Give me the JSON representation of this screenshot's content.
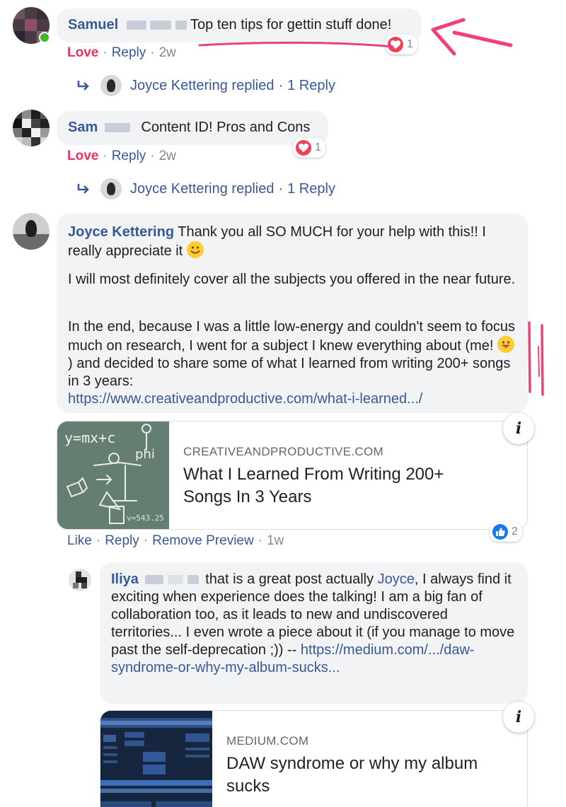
{
  "comments": [
    {
      "author": "Samuel",
      "text": "Top ten tips for gettin stuff done!",
      "actions": {
        "love": "Love",
        "reply": "Reply",
        "time": "2w"
      },
      "reaction_count": "1",
      "replied": {
        "name": "Joyce Kettering replied",
        "count": "1 Reply"
      }
    },
    {
      "author": "Sam",
      "text": "Content ID! Pros and Cons",
      "actions": {
        "love": "Love",
        "reply": "Reply",
        "time": "2w"
      },
      "reaction_count": "1",
      "replied": {
        "name": "Joyce Kettering replied",
        "count": "1 Reply"
      }
    },
    {
      "author": "Joyce Kettering",
      "text_p1": "Thank you all SO MUCH for your help with this!! I really appreciate it",
      "text_p2": "I will most definitely cover all the subjects you offered in the near future.",
      "text_p3a": "In the end, because I was a little low-energy and couldn't seem to focus much on research, I went for a subject I knew everything about (me!",
      "text_p3b": ") and decided to share some of what I learned from writing 200+ songs in 3 years:",
      "link": "https://www.creativeandproductive.com/what-i-learned.../",
      "preview": {
        "domain": "CREATIVEANDPRODUCTIVE.COM",
        "title": "What I Learned From Writing 200+ Songs In 3 Years",
        "image_text": [
          "y=mx+c",
          "phi",
          "v=543.25"
        ]
      },
      "actions": {
        "like": "Like",
        "reply": "Reply",
        "remove": "Remove Preview",
        "time": "1w"
      },
      "reaction_count": "2"
    },
    {
      "author": "Iliya",
      "text_a": "that is a great post actually",
      "mention": "Joyce",
      "text_b": ", I always find it exciting when experience does the talking! I am a big fan of collaboration too, as it leads to new and undiscovered territories... I even wrote a piece about it (if you manage to move past the self-deprecation ;)) --",
      "link": "https://medium.com/.../daw-syndrome-or-why-my-album-sucks...",
      "preview": {
        "domain": "MEDIUM.COM",
        "title": "DAW syndrome or why my album sucks"
      }
    }
  ],
  "info_label": "i",
  "colors": {
    "link": "#385898",
    "love": "#e9355d",
    "annotation": "#f0407a",
    "bubble": "#f2f3f5"
  },
  "icons": [
    "heart-icon",
    "like-icon",
    "reply-arrow-icon",
    "info-icon",
    "annotation-arrow",
    "annotation-marks"
  ]
}
